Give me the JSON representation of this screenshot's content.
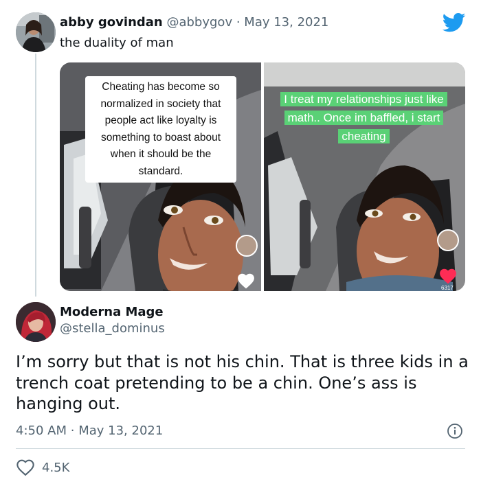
{
  "quoted_tweet": {
    "author_name": "abby govindan",
    "handle": "@abbygov",
    "separator": "·",
    "date": "May 13, 2021",
    "text": "the duality of man",
    "media": [
      {
        "caption": "Cheating has become so normalized in society that people act like loyalty is something to boast about when it should be the standard.",
        "liked": false
      },
      {
        "caption": "I treat my relationships just like math.. Once im baffled, i start cheating",
        "liked": true,
        "count": "6317"
      }
    ]
  },
  "reply": {
    "author_name": "Moderna Mage",
    "handle": "@stella_dominus",
    "text": "I’m sorry but that is not his chin. That is three kids in a trench coat pretending to be a chin. One’s ass is hanging out.",
    "time": "4:50 AM",
    "separator": "·",
    "date": "May 13, 2021"
  },
  "engagement": {
    "likes": "4.5K"
  },
  "icons": {
    "brand": "twitter-bird-icon",
    "info": "info-icon",
    "like": "heart-icon"
  },
  "colors": {
    "twitter_blue": "#1d9bf0",
    "secondary_text": "#536471",
    "caption_green": "#5ad176",
    "like_red": "#fe2c55"
  }
}
